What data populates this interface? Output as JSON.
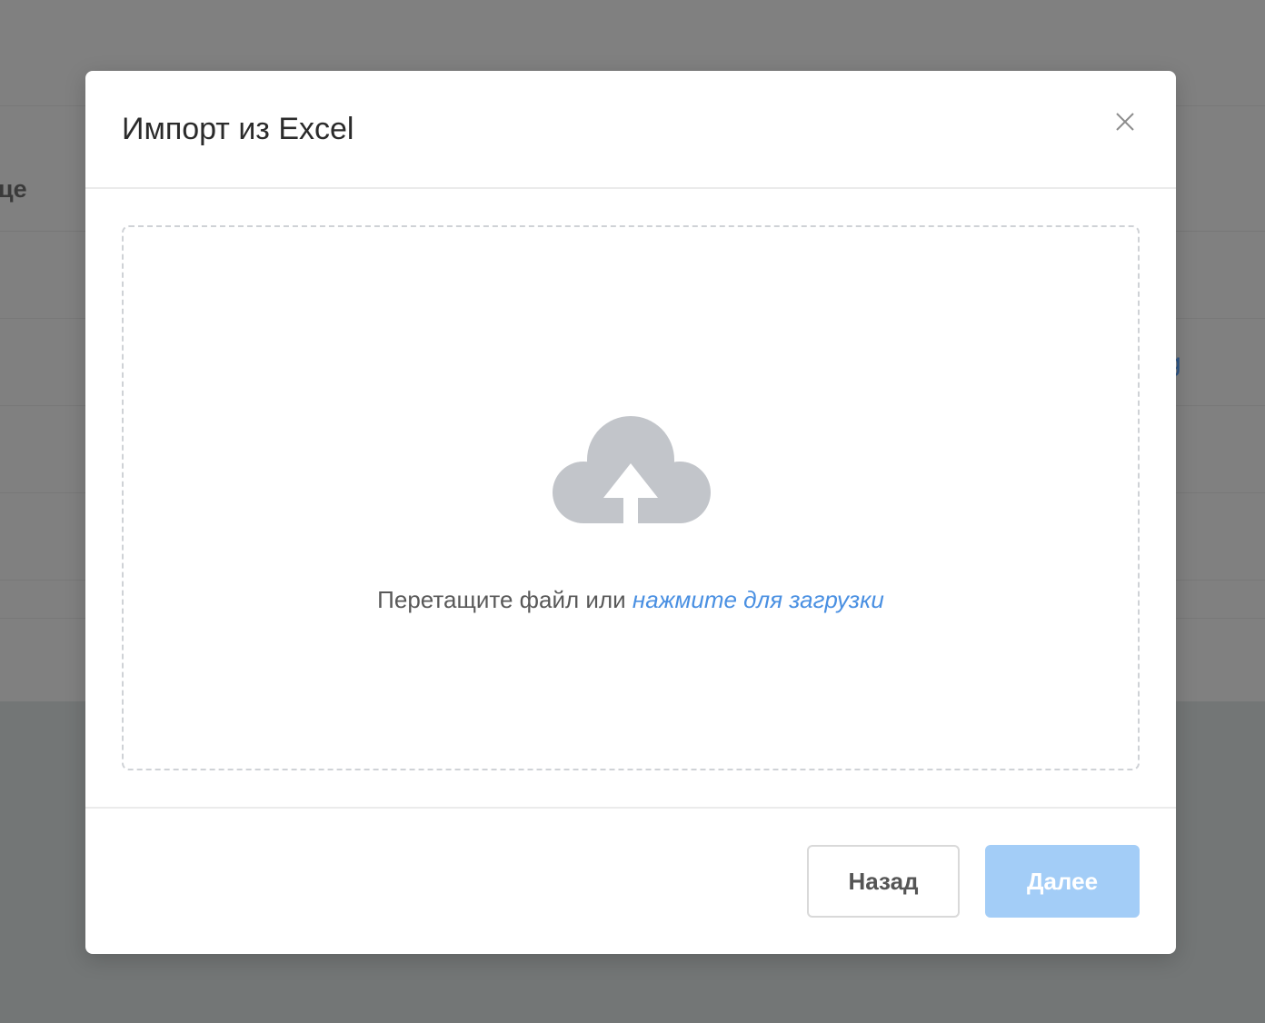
{
  "background": {
    "header_fragment": "це",
    "link_fragment": "g"
  },
  "modal": {
    "title": "Импорт из Excel",
    "close_icon": "close-icon",
    "dropzone": {
      "icon": "cloud-upload-icon",
      "text": "Перетащите файл или ",
      "link_text": "нажмите для загрузки"
    },
    "footer": {
      "back_label": "Назад",
      "next_label": "Далее",
      "next_disabled": true
    }
  },
  "colors": {
    "accent": "#4a90e2",
    "primary_disabled": "#a3cdf7",
    "overlay": "#808080"
  }
}
